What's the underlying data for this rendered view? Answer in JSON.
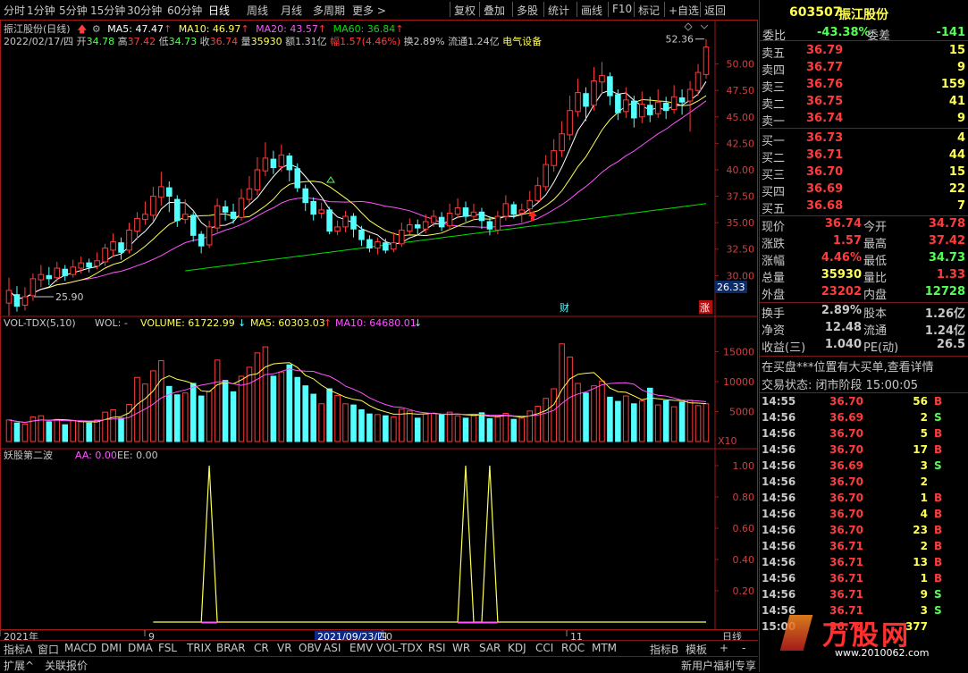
{
  "toolbar": {
    "periods": [
      "分时",
      "1分钟",
      "5分钟",
      "15分钟",
      "30分钟",
      "60分钟",
      "日线",
      "周线",
      "月线",
      "多周期",
      "更多 >"
    ],
    "selected_period": "日线",
    "actions": [
      "复权",
      "叠加",
      "多股",
      "统计",
      "画线",
      "F10",
      "标记",
      "+自选",
      "返回"
    ]
  },
  "stock": {
    "code": "603507",
    "name": "振江股份"
  },
  "chart_header": {
    "title": "振江股份(日线)",
    "ma5": "MA5: 47.47",
    "ma10": "MA10: 46.97",
    "ma20": "MA20: 43.57",
    "ma60": "MA60: 36.84",
    "date": "2022/02/17/四",
    "open_label": "开",
    "open": "34.78",
    "high_label": "高",
    "high": "37.42",
    "low_label": "低",
    "low": "34.73",
    "close_label": "收",
    "close": "36.74",
    "vol_label": "量",
    "vol": "35930",
    "amount": "额1.31亿",
    "change": "幅1.57(4.46%)",
    "turnover": "换2.89%",
    "float_cap": "流通1.24亿",
    "sector": "电气设备"
  },
  "price_axis": [
    "50.00",
    "47.50",
    "45.00",
    "42.50",
    "40.00",
    "37.50",
    "35.00",
    "32.50",
    "30.00"
  ],
  "price_annotations": {
    "high_mark": "52.36",
    "low_mark": "25.90",
    "cursor_price": "26.33",
    "cai_badge": "财",
    "zhang_badge": "涨"
  },
  "volume_header": {
    "name": "VOL-TDX(5,10)",
    "wol": "WOL: -",
    "volume": "VOLUME: 61722.99",
    "ma5": "MA5: 60303.03",
    "ma10": "MA10: 64680.01"
  },
  "volume_axis": [
    "15000",
    "10000",
    "5000"
  ],
  "volume_unit": "X10",
  "indicator_header": {
    "name": "妖股第二波",
    "aa": "AA: 0.00",
    "ee": "EE: 0.00"
  },
  "indicator_axis": [
    "1.00",
    "0.80",
    "0.60",
    "0.40",
    "0.20"
  ],
  "time_axis": {
    "year": "2021年",
    "m9": "9",
    "cursor_date": "2021/09/23/四",
    "m10": "0",
    "m11": "11",
    "period": "日线"
  },
  "bottom_tabs": [
    "指标A",
    "窗口",
    "MACD",
    "DMI",
    "DMA",
    "FSL",
    "TRIX",
    "BRAR",
    "CR",
    "VR",
    "OBV",
    "ASI",
    "EMV",
    "VOL-TDX",
    "RSI",
    "WR",
    "SAR",
    "KDJ",
    "CCI",
    "ROC",
    "MTM",
    "指标B",
    "模板",
    "+",
    "-"
  ],
  "status": {
    "expand": "扩展^",
    "related": "关联报价",
    "promo": "新用户福利专享"
  },
  "quote": {
    "webi_label": "委比",
    "webi": "-43.38%",
    "weicha_label": "委差",
    "weicha": "-141",
    "asks": [
      {
        "label": "卖五",
        "price": "36.79",
        "vol": "15"
      },
      {
        "label": "卖四",
        "price": "36.77",
        "vol": "9"
      },
      {
        "label": "卖三",
        "price": "36.76",
        "vol": "159"
      },
      {
        "label": "卖二",
        "price": "36.75",
        "vol": "41"
      },
      {
        "label": "卖一",
        "price": "36.74",
        "vol": "9"
      }
    ],
    "bids": [
      {
        "label": "买一",
        "price": "36.73",
        "vol": "4"
      },
      {
        "label": "买二",
        "price": "36.71",
        "vol": "44"
      },
      {
        "label": "买三",
        "price": "36.70",
        "vol": "15"
      },
      {
        "label": "买四",
        "price": "36.69",
        "vol": "22"
      },
      {
        "label": "买五",
        "price": "36.68",
        "vol": "7"
      }
    ],
    "stats": [
      {
        "l1": "现价",
        "v1": "36.74",
        "l2": "今开",
        "v2": "34.78"
      },
      {
        "l1": "涨跌",
        "v1": "1.57",
        "l2": "最高",
        "v2": "37.42"
      },
      {
        "l1": "涨幅",
        "v1": "4.46%",
        "l2": "最低",
        "v2": "34.73"
      },
      {
        "l1": "总量",
        "v1": "35930",
        "l2": "量比",
        "v2": "1.33"
      },
      {
        "l1": "外盘",
        "v1": "23202",
        "l2": "内盘",
        "v2": "12728"
      }
    ],
    "fund": [
      {
        "l1": "换手",
        "v1": "2.89%",
        "l2": "股本",
        "v2": "1.26亿"
      },
      {
        "l1": "净资",
        "v1": "12.48",
        "l2": "流通",
        "v2": "1.24亿"
      },
      {
        "l1": "收益(三)",
        "v1": "1.040",
        "l2": "PE(动)",
        "v2": "26.5"
      }
    ],
    "notice": "在买盘***位置有大买单,查看详情",
    "trade_status": "交易状态: 闭市阶段 15:00:05"
  },
  "ticks": [
    {
      "t": "14:55",
      "p": "36.70",
      "v": "56",
      "d": "B"
    },
    {
      "t": "14:56",
      "p": "36.69",
      "v": "2",
      "d": "S"
    },
    {
      "t": "14:56",
      "p": "36.70",
      "v": "5",
      "d": "B"
    },
    {
      "t": "14:56",
      "p": "36.70",
      "v": "17",
      "d": "B"
    },
    {
      "t": "14:56",
      "p": "36.69",
      "v": "3",
      "d": "S"
    },
    {
      "t": "14:56",
      "p": "36.70",
      "v": "2",
      "d": ""
    },
    {
      "t": "14:56",
      "p": "36.70",
      "v": "1",
      "d": "B"
    },
    {
      "t": "14:56",
      "p": "36.70",
      "v": "4",
      "d": "B"
    },
    {
      "t": "14:56",
      "p": "36.70",
      "v": "23",
      "d": "B"
    },
    {
      "t": "14:56",
      "p": "36.71",
      "v": "2",
      "d": "B"
    },
    {
      "t": "14:56",
      "p": "36.71",
      "v": "13",
      "d": "B"
    },
    {
      "t": "14:56",
      "p": "36.71",
      "v": "1",
      "d": "B"
    },
    {
      "t": "14:56",
      "p": "36.71",
      "v": "9",
      "d": "S"
    },
    {
      "t": "14:56",
      "p": "36.71",
      "v": "3",
      "d": "S"
    },
    {
      "t": "15:00",
      "p": "36.74",
      "v": "377",
      "d": ""
    }
  ],
  "watermark": {
    "text": "万股网",
    "url": "www.2010062.com"
  },
  "colors": {
    "up": "#ff3c3c",
    "down": "#54ffff",
    "ma5": "#ffffff",
    "ma10": "#ffff54",
    "ma20": "#ff54ff",
    "ma60": "#00e000",
    "border": "#a01818",
    "yellow": "#ffff54"
  }
}
